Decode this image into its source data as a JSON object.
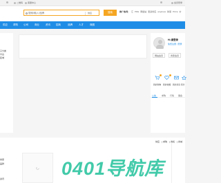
{
  "topbar": {
    "left_items": [
      "",
      "二维码",
      "客服中心"
    ],
    "right_items": [
      "",
      "会员登录"
    ]
  },
  "header": {
    "search": {
      "placeholder": "搜索/输入/品牌",
      "category": "供应",
      "button_label": "搜索"
    },
    "hot_label": "推广热词：",
    "hot_links": [
      "汇",
      "PDE",
      "网络站",
      "更多供应",
      "anyknow",
      "新丽",
      "Pizza",
      "价"
    ]
  },
  "nav": {
    "items": [
      "供应",
      "求购",
      "公司",
      "商业",
      "资讯",
      "招商",
      "品牌",
      "人才",
      "商圈"
    ]
  },
  "left_panel": {
    "lines": [
      "子分类",
      "平台",
      "区域"
    ]
  },
  "user_panel": {
    "greeting": "Hi,请登录",
    "greeting_sub": "免费注册 | 登录",
    "buttons": [
      "网站会员",
      "商家会员"
    ],
    "quick_actions": [
      {
        "label": "我的购物",
        "icon": "cart-icon"
      },
      {
        "label": "我的收藏",
        "icon": "heart-icon"
      },
      {
        "label": "我的消息",
        "icon": "mail-icon"
      },
      {
        "label": "积分",
        "icon": "star-icon"
      }
    ],
    "tabs": [
      "公告",
      "求购",
      "行情",
      "展会"
    ],
    "active_tab": 0
  },
  "lower": {
    "links": [
      "供应",
      "求购",
      "商机",
      "商城"
    ],
    "left_lines": [
      "商家",
      "品牌",
      "资讯"
    ]
  },
  "watermark": {
    "text": "0401导航库",
    "color": "#2ec4a0"
  },
  "colors": {
    "nav_blue": "#1f8de6",
    "accent_orange": "#f5a623"
  }
}
